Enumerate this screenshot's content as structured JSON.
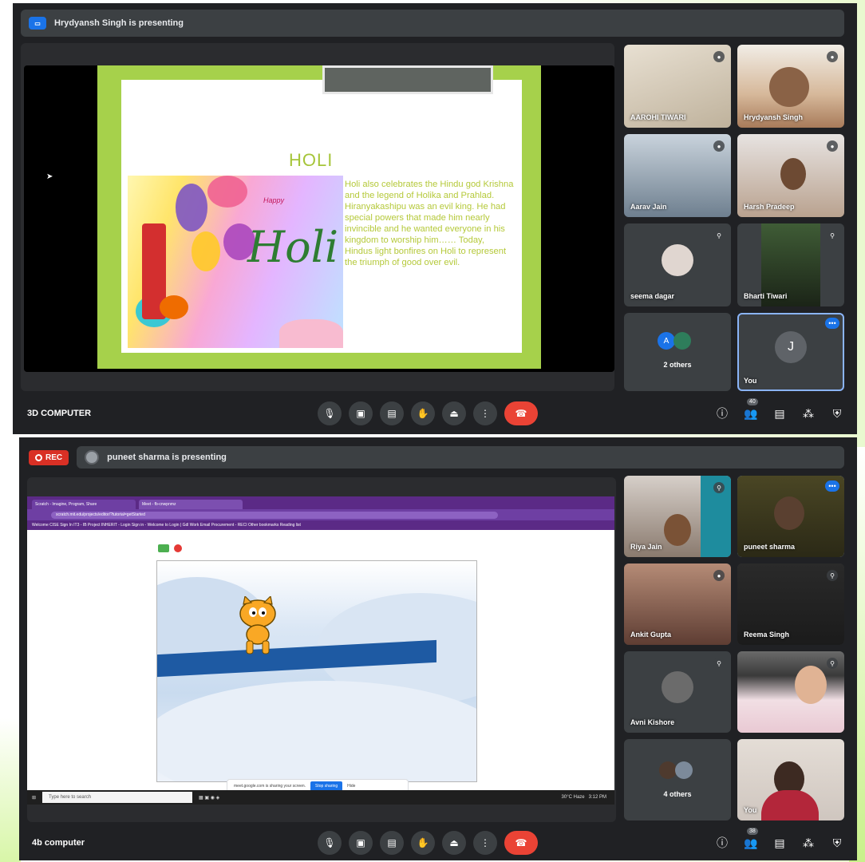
{
  "meet1": {
    "presenting_banner": "Hrydyansh Singh is presenting",
    "presenter_icon": "present-screen-icon",
    "slide": {
      "title": "HOLI",
      "image_small_text": "Happy",
      "image_word": "Holi",
      "body": "Holi also celebrates the Hindu god Krishna and the legend of Holika and Prahlad. Hiranyakashipu was an evil king. He had special powers that made him nearly invincible and he wanted everyone in his kingdom to worship him…… Today, Hindus light bonfires on Holi to represent the triumph of good over evil."
    },
    "participants": [
      {
        "name": "AAROHI TIWARI",
        "bg": "#cfc4b2"
      },
      {
        "name": "Hrydyansh Singh",
        "bg": "#d7c6b0"
      },
      {
        "name": "Aarav Jain",
        "bg": "#a9b8c7"
      },
      {
        "name": "Harsh Pradeep",
        "bg": "#d8d2cf"
      },
      {
        "name": "seema dagar",
        "bg": "#3c4043"
      },
      {
        "name": "Bharti Tiwari",
        "bg": "#2d3a2a"
      },
      {
        "name": "2 others",
        "bg": "#3c4043"
      },
      {
        "name": "You",
        "initial": "J",
        "bg": "#3c4043"
      }
    ],
    "meeting_name": "3D COMPUTER",
    "people_count": "40"
  },
  "meet2": {
    "rec_label": "REC",
    "presenting_banner": "puneet sharma is presenting",
    "browser": {
      "tab1": "Scratch - Imagine, Program, Share",
      "tab2": "Meet - fb-cnwpnmz",
      "url": "scratch.mit.edu/projects/editor/?tutorial=getStarted",
      "bookmarks": "Welcome  CISE Sign In  IT3 - IB Project  INHERIT - Login  Sign in - Welcome to  Login | Gdl  Work Email  Procurement - RECI  Other bookmarks  Reading list",
      "share_notice": "meet.google.com is sharing your screen.",
      "stop_label": "Stop sharing",
      "hide_label": "Hide",
      "search_placeholder": "Type here to search",
      "weather": "30°C Haze",
      "clock": "3:12 PM"
    },
    "participants": [
      {
        "name": "Riya Jain",
        "bg": "#b8a8a0"
      },
      {
        "name": "puneet sharma",
        "bg": "#3a3722"
      },
      {
        "name": "Ankit Gupta",
        "bg": "#9a6a5a"
      },
      {
        "name": "Reema Singh",
        "bg": "#242424"
      },
      {
        "name": "Avni Kishore",
        "bg": "#3c4043"
      },
      {
        "name": "",
        "bg": "#e8d7d0"
      },
      {
        "name": "4 others",
        "bg": "#3c4043"
      },
      {
        "name": "You",
        "bg": "#cfc8c2"
      }
    ],
    "meeting_name": "4b computer",
    "people_count": "38"
  },
  "controls": [
    {
      "name": "mic-icon",
      "glyph": "🎙"
    },
    {
      "name": "camera-icon",
      "glyph": "▣"
    },
    {
      "name": "captions-icon",
      "glyph": "▤"
    },
    {
      "name": "raise-hand-icon",
      "glyph": "✋"
    },
    {
      "name": "present-now-icon",
      "glyph": "⏏"
    },
    {
      "name": "more-options-icon",
      "glyph": "⋮"
    },
    {
      "name": "end-call-icon",
      "glyph": "☎"
    }
  ],
  "right_controls": [
    {
      "name": "info-icon",
      "glyph": "ⓘ"
    },
    {
      "name": "people-icon",
      "glyph": "👥"
    },
    {
      "name": "chat-icon",
      "glyph": "▤"
    },
    {
      "name": "activities-icon",
      "glyph": "⁂"
    },
    {
      "name": "host-controls-icon",
      "glyph": "⛨"
    }
  ]
}
